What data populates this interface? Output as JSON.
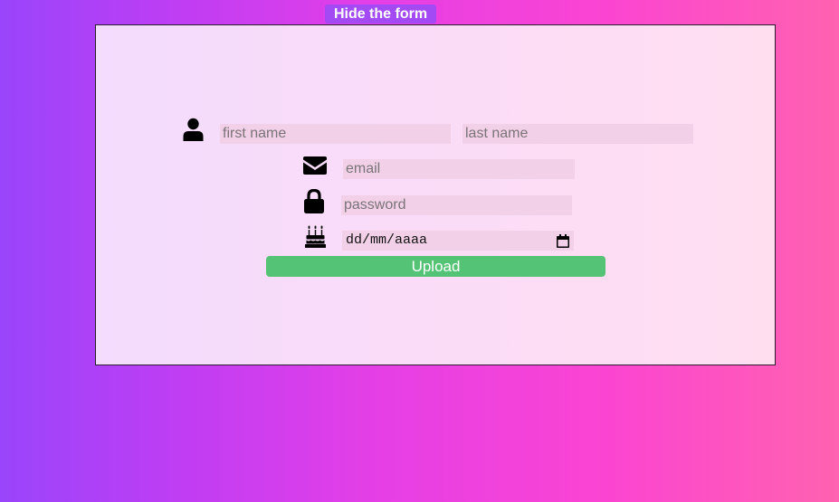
{
  "toggle": {
    "label": "Hide the form"
  },
  "form": {
    "first_name": {
      "placeholder": "first name",
      "icon": "user-icon"
    },
    "last_name": {
      "placeholder": "last name"
    },
    "email": {
      "placeholder": "email",
      "icon": "envelope-icon"
    },
    "password": {
      "placeholder": "password",
      "icon": "lock-icon"
    },
    "birthday": {
      "placeholder": "dd/mm/aaaa",
      "icon": "birthday-cake-icon",
      "picker_icon": "calendar-icon"
    },
    "upload_label": "Upload"
  },
  "colors": {
    "toggle_button": "#a34af4",
    "upload_button": "#55c375",
    "input_background": "#f2d1e8",
    "panel_background": "#fadcf8",
    "background_start": "#9a45fb",
    "background_end": "#ff62b0"
  }
}
